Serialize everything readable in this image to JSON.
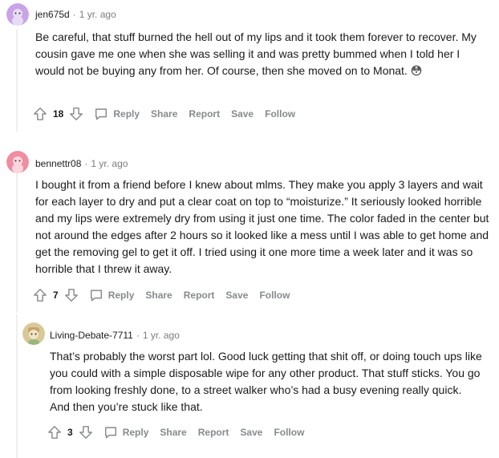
{
  "comments": [
    {
      "username": "jen675d",
      "age": "1 yr. ago",
      "body": "Be careful, that stuff burned the hell out of my lips and it took them forever to recover. My cousin gave me one when she was selling it and was pretty bummed when I told her I would not be buying any from her. Of course, then she moved on to Monat. 😳",
      "votes": "18",
      "avatar_color": "#c9a3e8"
    },
    {
      "username": "bennettr08",
      "age": "1 yr. ago",
      "body": "I bought it from a friend before I knew about mlms. They make you apply 3 layers and wait for each layer to dry and put a clear coat on top to “moisturize.” It seriously looked horrible and my lips were extremely dry from using it just one time. The color faded in the center but not around the edges after 2 hours so it looked like a mess until I was able to get home and get the removing gel to get it off. I tried using it one more time a week later and it was so horrible that I threw it away.",
      "votes": "7",
      "avatar_color": "#f08da0"
    },
    {
      "username": "Living-Debate-7711",
      "age": "1 yr. ago",
      "body": "That’s probably the worst part lol. Good luck getting that shit off, or doing touch ups like you could with a simple disposable wipe for any other product. That stuff sticks. You go from looking freshly done, to a street walker who’s had a busy evening really quick. And then you’re stuck like that.",
      "votes": "3",
      "avatar_color": "#d8c89a"
    }
  ],
  "actions": {
    "reply": "Reply",
    "share": "Share",
    "report": "Report",
    "save": "Save",
    "follow": "Follow"
  },
  "separator": "·"
}
